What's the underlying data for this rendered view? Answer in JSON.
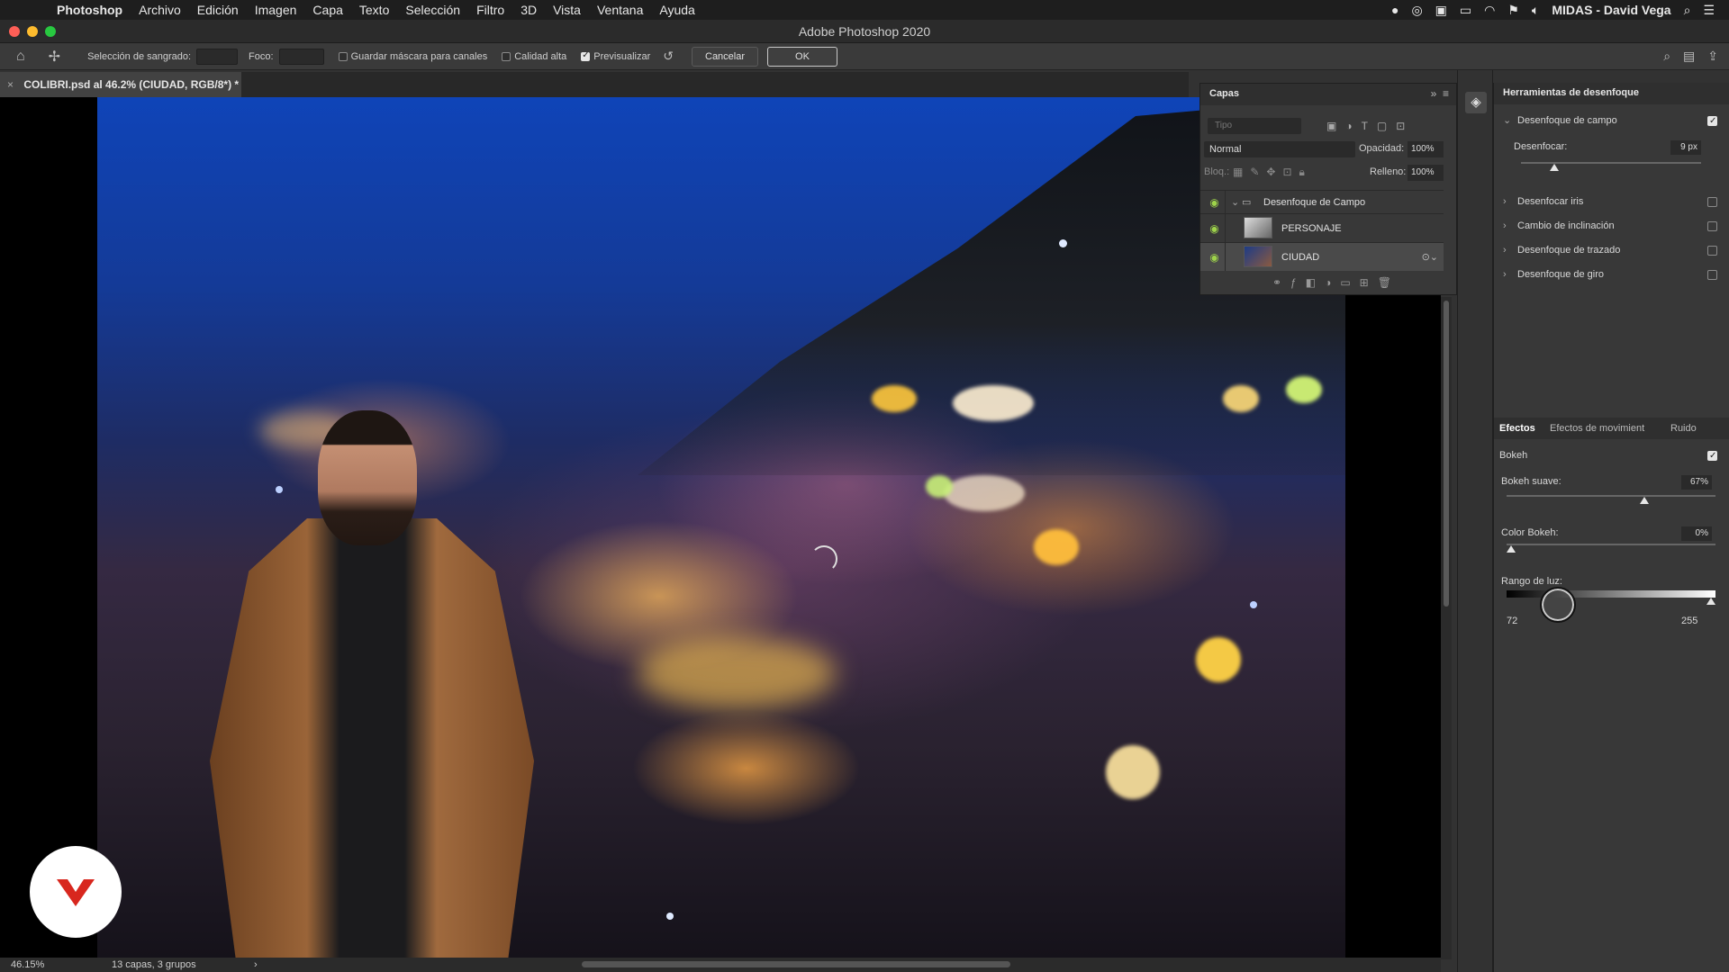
{
  "menubar": {
    "app_name": "Photoshop",
    "items": [
      "Archivo",
      "Edición",
      "Imagen",
      "Capa",
      "Texto",
      "Selección",
      "Filtro",
      "3D",
      "Vista",
      "Ventana",
      "Ayuda"
    ],
    "user": "MIDAS - David Vega"
  },
  "window": {
    "title": "Adobe Photoshop 2020"
  },
  "options": {
    "seleccion_label": "Selección de sangrado:",
    "foco_label": "Foco:",
    "guardar_label": "Guardar máscara para canales",
    "calidad_label": "Calidad alta",
    "previsualizar_label": "Previsualizar",
    "cancel_label": "Cancelar",
    "ok_label": "OK"
  },
  "document": {
    "tab_title": "COLIBRI.psd al 46.2% (CIUDAD, RGB/8*) *"
  },
  "status": {
    "zoom": "46.15%",
    "info": "13 capas, 3 grupos"
  },
  "layers_panel": {
    "title": "Capas",
    "search_placeholder": "Tipo",
    "blend_mode": "Normal",
    "opacity_label": "Opacidad:",
    "opacity_value": "100%",
    "lock_label": "Bloq.:",
    "fill_label": "Relleno:",
    "fill_value": "100%",
    "group_name": "Desenfoque de Campo",
    "layers": [
      "PERSONAJE",
      "CIUDAD"
    ]
  },
  "blur_panel": {
    "title": "Herramientas de desenfoque",
    "campo_label": "Desenfoque de campo",
    "desenfocar_label": "Desenfocar:",
    "desenfocar_value": "9 px",
    "iris_label": "Desenfocar iris",
    "inclinacion_label": "Cambio de inclinación",
    "trazado_label": "Desenfoque de trazado",
    "giro_label": "Desenfoque de giro",
    "tabs": [
      "Efectos",
      "Efectos de movimient",
      "Ruido"
    ],
    "bokeh_label": "Bokeh",
    "bokeh_suave_label": "Bokeh suave:",
    "bokeh_suave_value": "67%",
    "color_bokeh_label": "Color Bokeh:",
    "color_bokeh_value": "0%",
    "rango_label": "Rango de luz:",
    "rango_min": "72",
    "rango_max": "255"
  }
}
